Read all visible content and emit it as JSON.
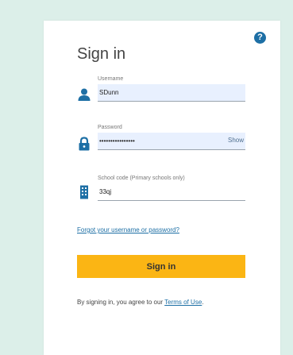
{
  "page": {
    "title": "Sign in"
  },
  "help": {
    "label": "?"
  },
  "fields": {
    "username": {
      "label": "Username",
      "value": "SDunn"
    },
    "password": {
      "label": "Password",
      "value": "••••••••••••••••",
      "show_label": "Show"
    },
    "school": {
      "label": "School code (Primary schools only)",
      "value": "33qj"
    }
  },
  "links": {
    "forgot": "Forgot your username or password?"
  },
  "actions": {
    "signin_label": "Sign in"
  },
  "agreement": {
    "prefix": "By signing in, you agree to our ",
    "terms_label": "Terms of Use",
    "suffix": "."
  },
  "colors": {
    "accent": "#fbb514",
    "icon": "#1d6fa5",
    "link": "#1d6fa5",
    "background": "#dcefe9"
  }
}
